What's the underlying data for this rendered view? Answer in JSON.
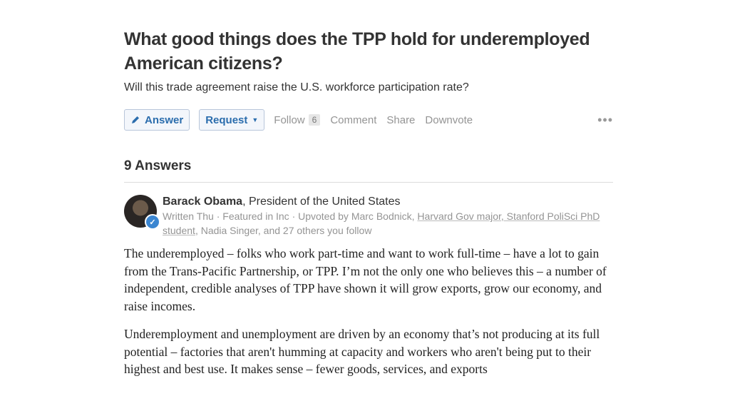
{
  "question": {
    "title": "What good things does the TPP hold for underemployed American citizens?",
    "detail": "Will this trade agreement raise the U.S. workforce participation rate?"
  },
  "actions": {
    "answer_label": "Answer",
    "request_label": "Request",
    "follow_label": "Follow",
    "follow_count": "6",
    "comment_label": "Comment",
    "share_label": "Share",
    "downvote_label": "Downvote",
    "more_label": "•••"
  },
  "answers": {
    "header": "9 Answers",
    "first": {
      "author_name": "Barack Obama",
      "author_credential": ", President of the United States",
      "meta_prefix": "Written Thu · Featured in Inc · Upvoted by Marc Bodnick, ",
      "upvoter_2": "Harvard Gov major, Stanford PoliSci PhD student",
      "meta_suffix": ", Nadia Singer, and 27 others you follow",
      "paragraph_1": "The underemployed – folks who work part-time and want to work full-time – have a lot to gain from the Trans-Pacific Partnership, or TPP. I’m not the only one who believes this – a number of independent, credible analyses of TPP have shown it will grow exports, grow our economy, and raise incomes.",
      "paragraph_2": "Underemployment and unemployment are driven by an economy that’s not producing at its full potential – factories that aren't humming at capacity and workers who aren't being put to their highest and best use. It makes sense – fewer goods, services, and exports"
    }
  },
  "colors": {
    "accent": "#2b6dad",
    "muted": "#949494",
    "verified": "#3b86d1"
  }
}
